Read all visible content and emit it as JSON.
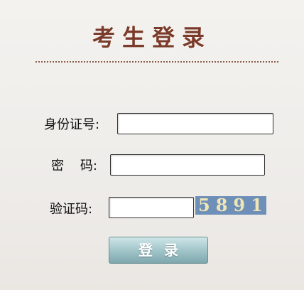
{
  "page": {
    "title": "考生登录"
  },
  "form": {
    "id_number": {
      "label": "身份证号:",
      "value": ""
    },
    "password": {
      "label": "密    码:",
      "value": ""
    },
    "captcha": {
      "label": "验证码:",
      "value": "",
      "image_text": "5891",
      "image_bg": "#6e8fb8"
    },
    "submit_label": "登录"
  },
  "colors": {
    "title": "#7a3b2a",
    "button": "#a6c9cd"
  }
}
